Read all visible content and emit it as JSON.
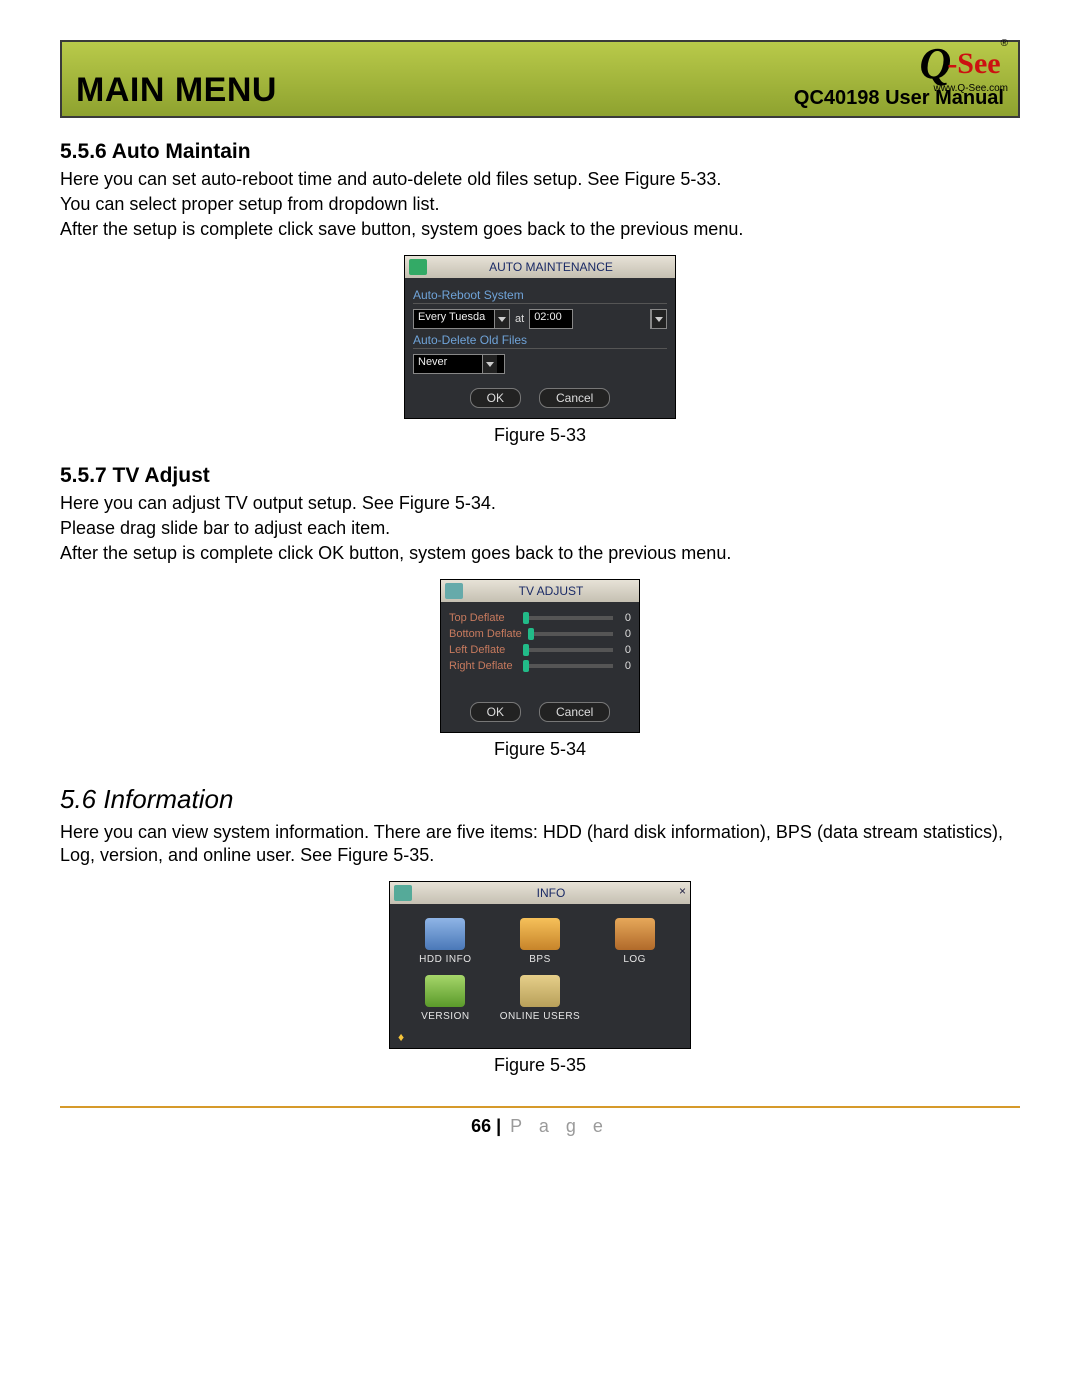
{
  "header": {
    "main_title": "MAIN MENU",
    "manual_label": "QC40198 User Manual",
    "logo_url": "www.Q-See.com",
    "logo_q": "Q",
    "logo_see": "-See"
  },
  "section_556": {
    "heading": "5.5.6  Auto Maintain",
    "p1": "Here you can set auto-reboot time and auto-delete old files setup. See Figure 5-33.",
    "p2": "You can select proper setup from dropdown list.",
    "p3": "After the setup is complete click save button, system goes back to the previous menu."
  },
  "fig533": {
    "title": "AUTO MAINTENANCE",
    "label_reboot": "Auto-Reboot System",
    "combo_day": "Every Tuesda",
    "at": "at",
    "combo_time": "02:00",
    "label_delete": "Auto-Delete Old Files",
    "combo_never": "Never",
    "btn_ok": "OK",
    "btn_cancel": "Cancel",
    "caption": "Figure 5-33"
  },
  "section_557": {
    "heading": "5.5.7  TV Adjust",
    "p1": "Here you can adjust TV output setup. See Figure 5-34.",
    "p2": "Please drag slide bar to adjust each item.",
    "p3": "After the setup is complete click OK button, system goes back to the previous menu."
  },
  "fig534": {
    "title": "TV ADJUST",
    "rows": [
      {
        "name": "Top Deflate",
        "val": "0"
      },
      {
        "name": "Bottom Deflate",
        "val": "0"
      },
      {
        "name": "Left Deflate",
        "val": "0"
      },
      {
        "name": "Right Deflate",
        "val": "0"
      }
    ],
    "btn_ok": "OK",
    "btn_cancel": "Cancel",
    "caption": "Figure 5-34"
  },
  "section_56": {
    "heading": "5.6    Information",
    "p1": "Here you can view system information. There are five items: HDD (hard disk information), BPS (data stream statistics), Log, version, and online user. See Figure 5-35."
  },
  "fig535": {
    "title": "INFO",
    "items": [
      {
        "label": "HDD INFO"
      },
      {
        "label": "BPS"
      },
      {
        "label": "LOG"
      },
      {
        "label": "VERSION"
      },
      {
        "label": "ONLINE USERS"
      }
    ],
    "caption": "Figure 5-35"
  },
  "footer": {
    "page_num": "66",
    "bar": " | ",
    "page_word": "P a g e"
  }
}
